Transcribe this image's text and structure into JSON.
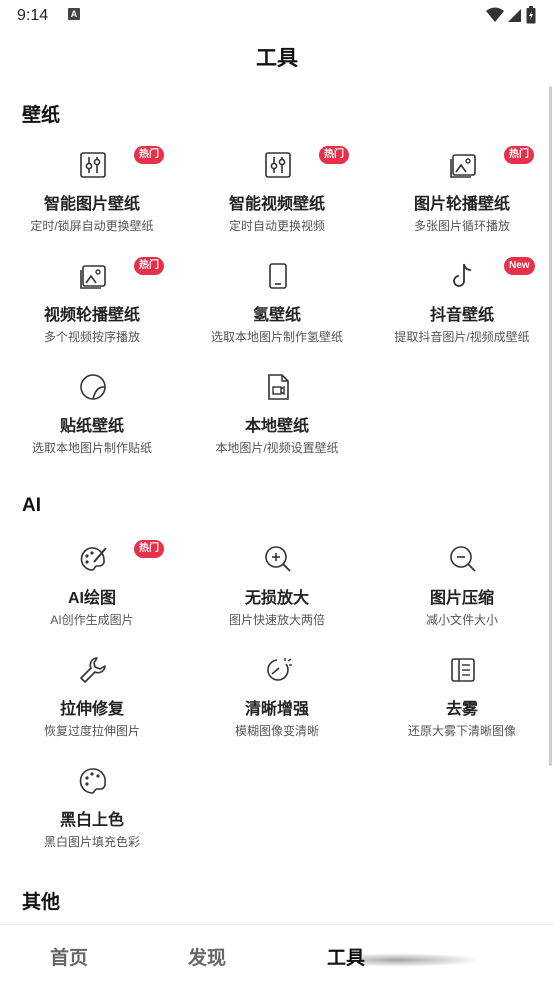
{
  "status": {
    "time": "9:14",
    "a_icon": "A"
  },
  "page_title": "工具",
  "sections": [
    {
      "title": "壁纸",
      "items": [
        {
          "name": "智能图片壁纸",
          "desc": "定时/锁屏自动更换壁纸",
          "icon": "sliders-icon",
          "badge": "热门"
        },
        {
          "name": "智能视频壁纸",
          "desc": "定时自动更换视频",
          "icon": "sliders-icon",
          "badge": "热门"
        },
        {
          "name": "图片轮播壁纸",
          "desc": "多张图片循环播放",
          "icon": "image-stack-icon",
          "badge": "热门"
        },
        {
          "name": "视频轮播壁纸",
          "desc": "多个视频按序播放",
          "icon": "image-stack-icon",
          "badge": "热门"
        },
        {
          "name": "氢壁纸",
          "desc": "选取本地图片制作氢壁纸",
          "icon": "phone-icon",
          "badge": ""
        },
        {
          "name": "抖音壁纸",
          "desc": "提取抖音图片/视频成壁纸",
          "icon": "tiktok-icon",
          "badge": "New"
        },
        {
          "name": "贴纸壁纸",
          "desc": "选取本地图片制作贴纸",
          "icon": "sticker-icon",
          "badge": ""
        },
        {
          "name": "本地壁纸",
          "desc": "本地图片/视频设置壁纸",
          "icon": "file-video-icon",
          "badge": ""
        }
      ]
    },
    {
      "title": "AI",
      "items": [
        {
          "name": "AI绘图",
          "desc": "AI创作生成图片",
          "icon": "palette-brush-icon",
          "badge": "热门"
        },
        {
          "name": "无损放大",
          "desc": "图片快速放大两倍",
          "icon": "zoom-in-icon",
          "badge": ""
        },
        {
          "name": "图片压缩",
          "desc": "减小文件大小",
          "icon": "zoom-out-icon",
          "badge": ""
        },
        {
          "name": "拉伸修复",
          "desc": "恢复过度拉伸图片",
          "icon": "wrench-icon",
          "badge": ""
        },
        {
          "name": "清晰增强",
          "desc": "模糊图像变清晰",
          "icon": "enhance-icon",
          "badge": ""
        },
        {
          "name": "去雾",
          "desc": "还原大雾下清晰图像",
          "icon": "dehaze-icon",
          "badge": ""
        },
        {
          "name": "黑白上色",
          "desc": "黑白图片填充色彩",
          "icon": "palette-icon",
          "badge": ""
        }
      ]
    },
    {
      "title": "其他",
      "items": []
    }
  ],
  "bottom_nav": [
    {
      "label": "首页",
      "active": false
    },
    {
      "label": "发现",
      "active": false
    },
    {
      "label": "工具",
      "active": true
    }
  ],
  "colors": {
    "badge": "#e8304a",
    "text": "#222222",
    "muted": "#555555"
  }
}
